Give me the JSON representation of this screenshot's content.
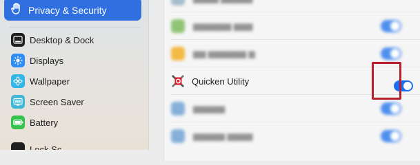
{
  "sidebar": {
    "selected": {
      "label": "Privacy & Security",
      "icon": "hand-icon"
    },
    "items": [
      {
        "label": "Desktop & Dock",
        "icon": "dock-icon"
      },
      {
        "label": "Displays",
        "icon": "sun-icon"
      },
      {
        "label": "Wallpaper",
        "icon": "flower-icon"
      },
      {
        "label": "Screen Saver",
        "icon": "screen-saver-icon"
      },
      {
        "label": "Battery",
        "icon": "battery-icon"
      }
    ],
    "partial_item": {
      "label": "Lock Sc",
      "icon": "lock-icon"
    }
  },
  "main": {
    "focused_app": {
      "name": "Quicken Utility",
      "toggle_on": true
    },
    "blurred_rows": 6
  },
  "colors": {
    "accent": "#2f6fe0",
    "toggle_on": "#1d6ff2",
    "highlight": "#b5202a"
  }
}
